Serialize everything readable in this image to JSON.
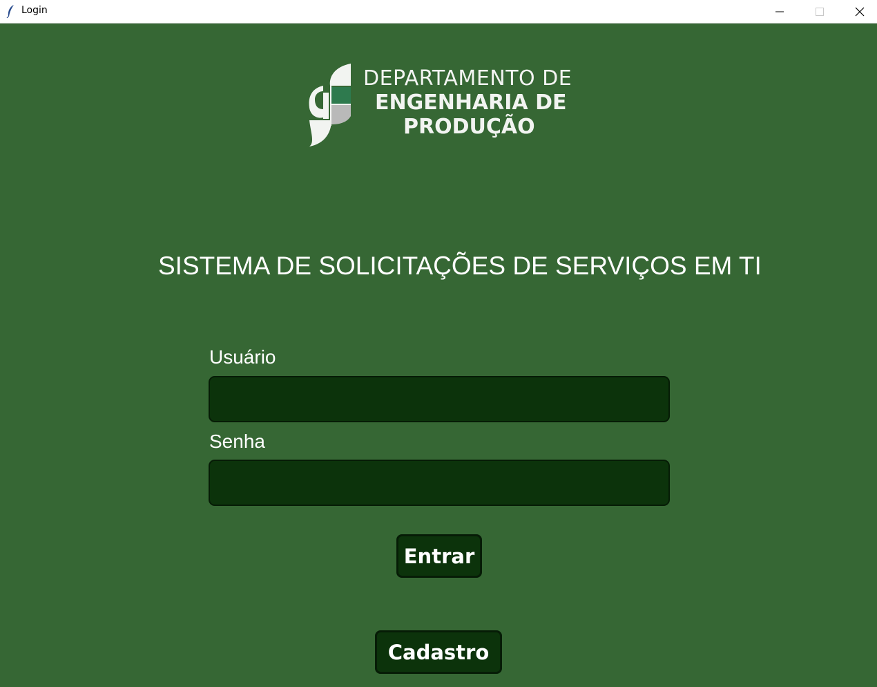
{
  "window": {
    "title": "Login",
    "controls": [
      "minimize-icon",
      "maximize-icon",
      "close-icon"
    ]
  },
  "logo": {
    "line1": "DEPARTAMENTO DE",
    "line2": "ENGENHARIA DE",
    "line3": "PRODUÇÃO"
  },
  "heading": "SISTEMA DE SOLICITAÇÕES DE SERVIÇOS EM TI",
  "form": {
    "user_label": "Usuário",
    "user_value": "",
    "password_label": "Senha",
    "password_value": ""
  },
  "buttons": {
    "login": "Entrar",
    "register": "Cadastro"
  },
  "colors": {
    "background": "#366734",
    "field_bg": "#0c330b",
    "text": "#ffffff"
  }
}
